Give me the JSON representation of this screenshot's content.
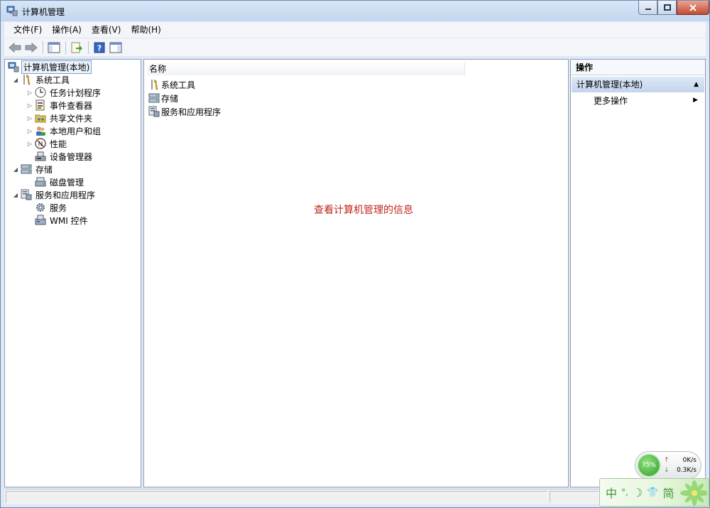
{
  "window": {
    "title": "计算机管理"
  },
  "menu": [
    "文件(F)",
    "操作(A)",
    "查看(V)",
    "帮助(H)"
  ],
  "tree": {
    "root": "计算机管理(本地)",
    "items": [
      {
        "label": "系统工具",
        "level": 1,
        "expanded": true
      },
      {
        "label": "任务计划程序",
        "level": 2,
        "expanded": false
      },
      {
        "label": "事件查看器",
        "level": 2,
        "expanded": false
      },
      {
        "label": "共享文件夹",
        "level": 2,
        "expanded": false
      },
      {
        "label": "本地用户和组",
        "level": 2,
        "expanded": false
      },
      {
        "label": "性能",
        "level": 2,
        "expanded": false
      },
      {
        "label": "设备管理器",
        "level": 2
      },
      {
        "label": "存储",
        "level": 1,
        "expanded": true
      },
      {
        "label": "磁盘管理",
        "level": 2
      },
      {
        "label": "服务和应用程序",
        "level": 1,
        "expanded": true
      },
      {
        "label": "服务",
        "level": 2
      },
      {
        "label": "WMI 控件",
        "level": 2
      }
    ]
  },
  "center": {
    "column_header": "名称",
    "rows": [
      "系统工具",
      "存储",
      "服务和应用程序"
    ],
    "info_text": "查看计算机管理的信息"
  },
  "actions": {
    "header": "操作",
    "section": "计算机管理(本地)",
    "item": "更多操作"
  },
  "netmeter": {
    "percent": "75%",
    "up": "0K/s",
    "down": "0.3K/s"
  },
  "ime": [
    "中",
    "°,",
    "☽",
    "👕",
    "简"
  ],
  "colors": {
    "info_text": "#c0261f",
    "selection_border": "#7da2ce",
    "ime_green": "#3c9a33"
  }
}
